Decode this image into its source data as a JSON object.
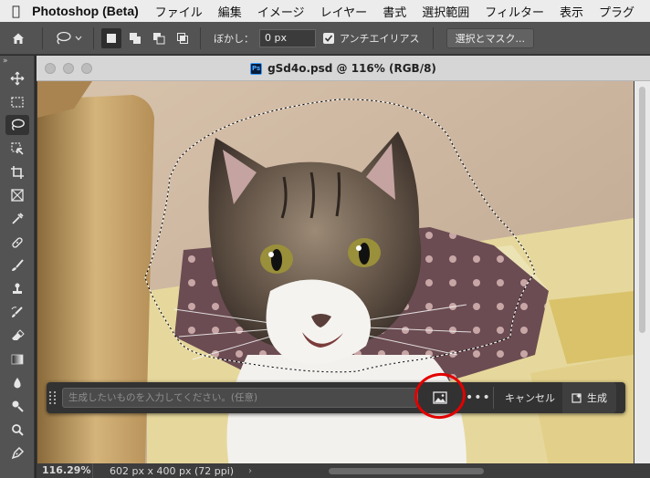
{
  "menubar": {
    "app_name": "Photoshop (Beta)",
    "items": [
      "ファイル",
      "編集",
      "イメージ",
      "レイヤー",
      "書式",
      "選択範囲",
      "フィルター",
      "表示",
      "プラグ"
    ]
  },
  "options_bar": {
    "feather_label": "ぼかし：",
    "feather_value": "0 px",
    "antialias_label": "アンチエイリアス",
    "antialias_checked": true,
    "select_mask_label": "選択とマスク..."
  },
  "tools": {
    "collapse_glyph": "»",
    "items": [
      "move-icon",
      "marquee-icon",
      "lasso-icon",
      "object-select-icon",
      "crop-icon",
      "frame-icon",
      "eyedropper-icon",
      "healing-brush-icon",
      "brush-icon",
      "stamp-icon",
      "history-brush-icon",
      "eraser-icon",
      "gradient-icon",
      "blur-icon",
      "dodge-icon",
      "burn-icon",
      "pen-icon"
    ],
    "active": "lasso-icon"
  },
  "document": {
    "ps_badge": "Ps",
    "title": "gSd4o.psd @ 116% (RGB/8)"
  },
  "status": {
    "zoom": "116.29%",
    "dimensions": "602 px x 400 px (72 ppi)",
    "arrow": "›"
  },
  "taskbar": {
    "prompt_placeholder": "生成したいものを入力してください。(任意)",
    "more_label": "•••",
    "cancel_label": "キャンセル",
    "generate_label": "生成"
  },
  "colors": {
    "annotation_circle": "#e30000",
    "menubar_bg": "#ececec",
    "panel_bg": "#535353"
  }
}
